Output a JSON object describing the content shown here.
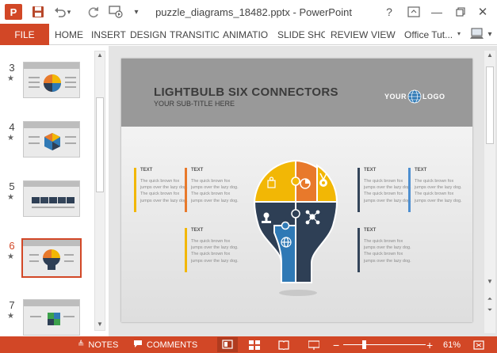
{
  "titlebar": {
    "app_icon": "P",
    "title": "puzzle_diagrams_18482.pptx - PowerPoint",
    "icons": [
      "powerpoint-app-icon",
      "save-icon",
      "undo-icon",
      "redo-icon",
      "present-from-start-icon",
      "customize-qat-icon",
      "help-icon",
      "ribbon-display-options-icon",
      "minimize-icon",
      "restore-icon",
      "close-icon"
    ],
    "help": "?",
    "minimize": "—",
    "close": "✕"
  },
  "ribbon": {
    "file": "FILE",
    "tabs": [
      "HOME",
      "INSERT",
      "DESIGN",
      "TRANSITIO",
      "ANIMATIO",
      "SLIDE SHO",
      "REVIEW",
      "VIEW"
    ],
    "account": "Office Tut..."
  },
  "thumbnails": [
    {
      "number": "3",
      "selected": false
    },
    {
      "number": "4",
      "selected": false
    },
    {
      "number": "5",
      "selected": false
    },
    {
      "number": "6",
      "selected": true
    },
    {
      "number": "7",
      "selected": false
    }
  ],
  "slide": {
    "title": "LIGHTBULB SIX CONNECTORS",
    "subtitle": "YOUR SUB-TITLE HERE",
    "logo_left": "YOUR",
    "logo_right": "LOGO",
    "connectors": [
      {
        "heading": "TEXT",
        "body": "The quick brown fox jumps over the lazy dog. The quick brown fox jumps over the lazy dog.",
        "color": "#f2b705"
      },
      {
        "heading": "TEXT",
        "body": "The quick brown fox jumps over the lazy dog. The quick brown fox jumps over the lazy dog.",
        "color": "#e8792b"
      },
      {
        "heading": "TEXT",
        "body": "The quick brown fox jumps over the lazy dog. The quick brown fox jumps over the lazy dog.",
        "color": "#f2b705"
      },
      {
        "heading": "TEXT",
        "body": "The quick brown fox jumps over the lazy dog. The quick brown fox jumps over the lazy dog.",
        "color": "#34455a"
      },
      {
        "heading": "TEXT",
        "body": "The quick brown fox jumps over the lazy dog. The quick brown fox jumps over the lazy dog.",
        "color": "#4e8fd0"
      },
      {
        "heading": "TEXT",
        "body": "The quick brown fox jumps over the lazy dog. The quick brown fox jumps over the lazy dog.",
        "color": "#34455a"
      }
    ],
    "bulb_colors": {
      "yellow": "#f2b705",
      "orange": "#e8792b",
      "navy": "#2e3f55",
      "blue": "#2f79b5"
    }
  },
  "statusbar": {
    "notes": "NOTES",
    "comments": "COMMENTS",
    "zoom_minus": "−",
    "zoom_plus": "+",
    "zoom": "61%"
  },
  "colors": {
    "accent": "#d24726"
  }
}
